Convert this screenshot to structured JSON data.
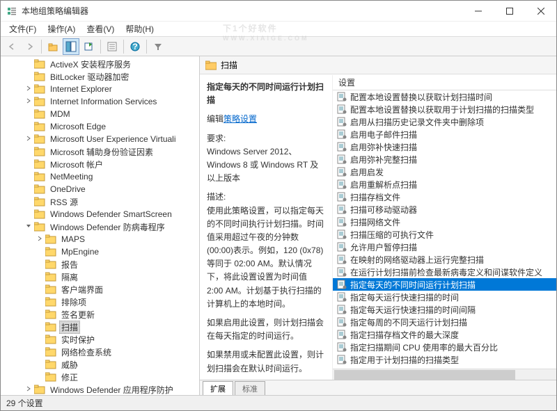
{
  "window": {
    "title": "本地组策略编辑器"
  },
  "menu": {
    "file": "文件(F)",
    "action": "操作(A)",
    "view": "查看(V)",
    "help": "帮助(H)"
  },
  "tree": {
    "items": [
      {
        "d": 2,
        "e": "",
        "l": "ActiveX 安装程序服务"
      },
      {
        "d": 2,
        "e": "",
        "l": "BitLocker 驱动器加密"
      },
      {
        "d": 2,
        "e": ">",
        "l": "Internet Explorer"
      },
      {
        "d": 2,
        "e": ">",
        "l": "Internet Information Services"
      },
      {
        "d": 2,
        "e": "",
        "l": "MDM"
      },
      {
        "d": 2,
        "e": "",
        "l": "Microsoft Edge"
      },
      {
        "d": 2,
        "e": ">",
        "l": "Microsoft User Experience Virtuali"
      },
      {
        "d": 2,
        "e": "",
        "l": "Microsoft 辅助身份验证因素"
      },
      {
        "d": 2,
        "e": "",
        "l": "Microsoft 帐户"
      },
      {
        "d": 2,
        "e": "",
        "l": "NetMeeting"
      },
      {
        "d": 2,
        "e": "",
        "l": "OneDrive"
      },
      {
        "d": 2,
        "e": "",
        "l": "RSS 源"
      },
      {
        "d": 2,
        "e": "",
        "l": "Windows Defender SmartScreen"
      },
      {
        "d": 2,
        "e": "v",
        "l": "Windows Defender 防病毒程序"
      },
      {
        "d": 3,
        "e": ">",
        "l": "MAPS"
      },
      {
        "d": 3,
        "e": "",
        "l": "MpEngine"
      },
      {
        "d": 3,
        "e": "",
        "l": "报告"
      },
      {
        "d": 3,
        "e": "",
        "l": "隔离"
      },
      {
        "d": 3,
        "e": "",
        "l": "客户端界面"
      },
      {
        "d": 3,
        "e": "",
        "l": "排除项"
      },
      {
        "d": 3,
        "e": "",
        "l": "签名更新"
      },
      {
        "d": 3,
        "e": "",
        "l": "扫描",
        "sel": true
      },
      {
        "d": 3,
        "e": "",
        "l": "实时保护"
      },
      {
        "d": 3,
        "e": "",
        "l": "网络检查系统"
      },
      {
        "d": 3,
        "e": "",
        "l": "威胁"
      },
      {
        "d": 3,
        "e": "",
        "l": "修正"
      },
      {
        "d": 2,
        "e": ">",
        "l": "Windows Defender 应用程序防护"
      }
    ]
  },
  "right_header": "扫描",
  "detail": {
    "title": "指定每天的不同时间运行计划扫描",
    "edit_label": "编辑",
    "edit_link": "策略设置",
    "req_label": "要求:",
    "req_text": "Windows Server 2012、Windows 8 或 Windows RT 及以上版本",
    "desc_label": "描述:",
    "desc1": "使用此策略设置，可以指定每天的不同时间执行计划扫描。时间值采用超过午夜的分钟数(00:00)表示。例如，120 (0x78)等同于 02:00 AM。默认情况下，将此设置设置为时间值 2:00 AM。计划基于执行扫描的计算机上的本地时间。",
    "desc2": "如果启用此设置，则计划扫描会在每天指定的时间运行。",
    "desc3": "如果禁用或未配置此设置，则计划扫描会在默认时间运行。"
  },
  "settings": {
    "header": "设置",
    "items": [
      "配置本地设置替换以获取计划扫描时间",
      "配置本地设置替换以获取用于计划扫描的扫描类型",
      "启用从扫描历史记录文件夹中删除项",
      "启用电子邮件扫描",
      "启用弥补快速扫描",
      "启用弥补完整扫描",
      "启用启发",
      "启用重解析点扫描",
      "扫描存档文件",
      "扫描可移动驱动器",
      "扫描网络文件",
      "扫描压缩的可执行文件",
      "允许用户暂停扫描",
      "在映射的网络驱动器上运行完整扫描",
      "在运行计划扫描前检查最新病毒定义和间谍软件定义",
      "指定每天的不同时间运行计划扫描",
      "指定每天运行快速扫描的时间",
      "指定每天运行快速扫描的时间间隔",
      "指定每周的不同天运行计划扫描",
      "指定扫描存档文件的最大深度",
      "指定扫描期间 CPU 使用率的最大百分比",
      "指定用于计划扫描的扫描类型"
    ],
    "selected_index": 15
  },
  "tabs": {
    "extended": "扩展",
    "standard": "标准"
  },
  "status": "29 个设置",
  "watermark": {
    "main": "下1个好软件",
    "sub": "WWW.XIAIGE.COM"
  }
}
